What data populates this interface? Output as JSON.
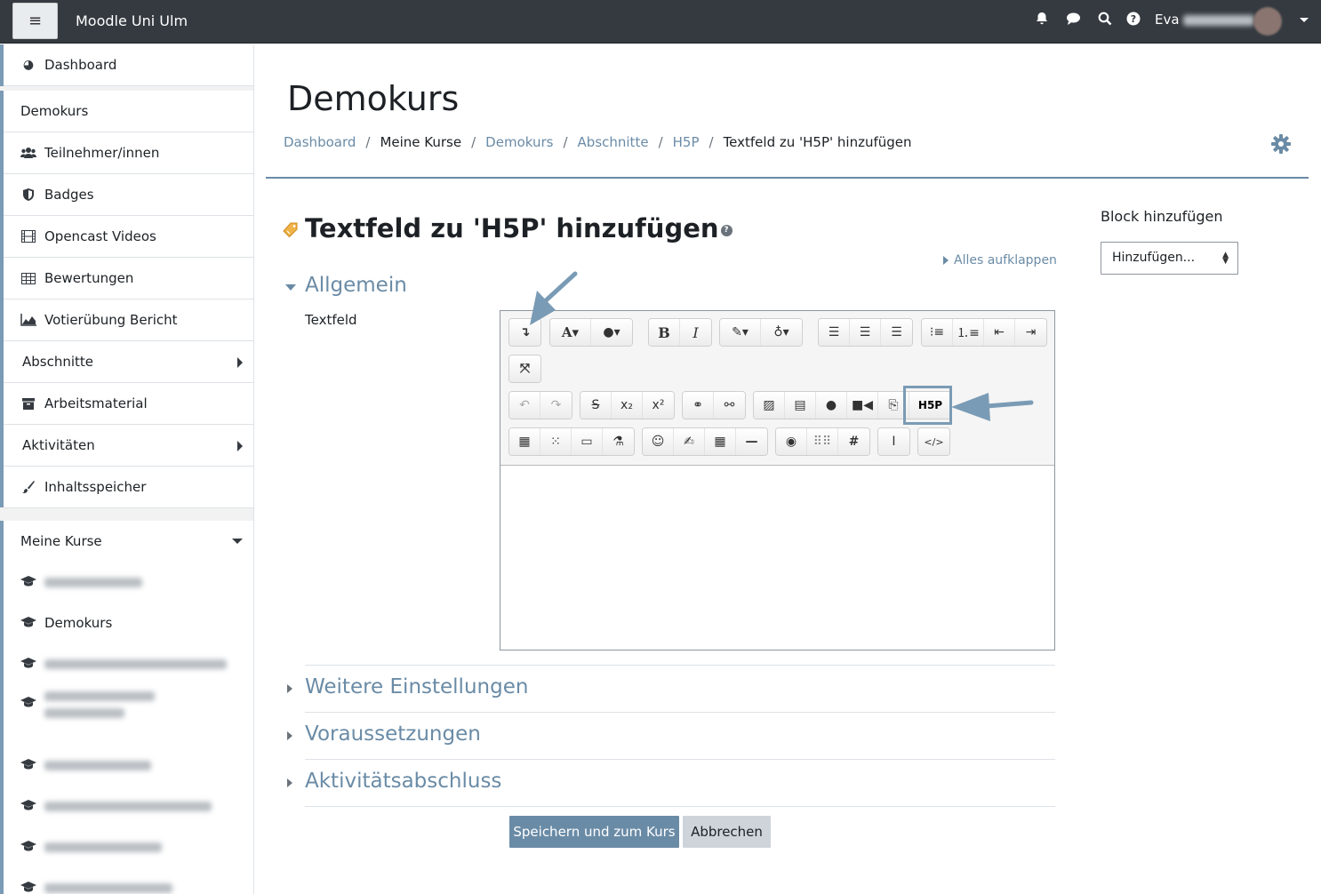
{
  "navbar": {
    "menu_icon": "hamburger-icon",
    "site_name": "Moodle Uni Ulm",
    "user_name": "Eva",
    "icons": [
      "bell-icon",
      "chat-icon",
      "search-icon",
      "help-icon"
    ]
  },
  "drawer": {
    "group1": [
      {
        "label": "Dashboard",
        "icon": "dashboard-icon"
      }
    ],
    "group2": [
      {
        "label": "Demokurs",
        "icon": ""
      },
      {
        "label": "Teilnehmer/innen",
        "icon": "users-icon"
      },
      {
        "label": "Badges",
        "icon": "shield-icon"
      },
      {
        "label": "Opencast Videos",
        "icon": "film-icon"
      },
      {
        "label": "Bewertungen",
        "icon": "table-icon"
      },
      {
        "label": "Votierübung Bericht",
        "icon": "chart-icon"
      },
      {
        "label": "Abschnitte",
        "icon": ""
      },
      {
        "label": "Arbeitsmaterial",
        "icon": "archive-icon"
      },
      {
        "label": "Aktivitäten",
        "icon": ""
      },
      {
        "label": "Inhaltsspeicher",
        "icon": "brush-icon"
      }
    ],
    "my_courses": {
      "label": "Meine Kurse",
      "courses": [
        "",
        "Demokurs",
        "",
        "",
        "",
        "",
        "",
        ""
      ]
    }
  },
  "main": {
    "page_title": "Demokurs",
    "breadcrumb": [
      {
        "label": "Dashboard",
        "link": true
      },
      {
        "label": "Meine Kurse",
        "link": false
      },
      {
        "label": "Demokurs",
        "link": true
      },
      {
        "label": "Abschnitte",
        "link": true
      },
      {
        "label": "H5P",
        "link": true
      },
      {
        "label": "Textfeld zu 'H5P' hinzufügen",
        "link": false
      }
    ],
    "form_title": "Textfeld zu 'H5P' hinzufügen",
    "expand_all": "Alles aufklappen",
    "sections": {
      "general": "Allgemein",
      "more": "Weitere Einstellungen",
      "restrictions": "Voraussetzungen",
      "completion": "Aktivitätsabschluss"
    },
    "field_label": "Textfeld",
    "editor_value": "",
    "buttons": {
      "save": "Speichern und zum Kurs",
      "cancel": "Abbrechen"
    }
  },
  "toolbar": {
    "rows": [
      [
        [
          "collapse-icon"
        ],
        [
          "font-style-icon",
          "font-color-icon"
        ],
        [
          "bold-icon",
          "italic-icon"
        ],
        [
          "highlight-icon",
          "accessibility-checker-icon"
        ],
        [
          "align-left-icon",
          "align-center-icon",
          "align-right-icon"
        ],
        [
          "unordered-list-icon",
          "ordered-list-icon",
          "outdent-icon",
          "indent-icon"
        ]
      ],
      [
        [
          "fullscreen-icon"
        ]
      ],
      [
        [
          "undo-icon",
          "redo-icon"
        ],
        [
          "strikethrough-icon",
          "subscript-icon",
          "superscript-icon"
        ],
        [
          "link-icon",
          "unlink-icon"
        ],
        [
          "image-icon",
          "media-icon",
          "record-audio-icon",
          "record-video-icon",
          "manage-files-icon",
          "h5p-icon"
        ]
      ],
      [
        [
          "calculator-icon",
          "keypad-icon",
          "screen-icon",
          "chemistry-icon"
        ],
        [
          "emoji-icon",
          "edit-icon",
          "table-icon",
          "horizontal-rule-icon"
        ],
        [
          "accessibility-icon",
          "braille-icon",
          "hash-icon"
        ],
        [
          "cursor-icon"
        ],
        [
          "html-icon"
        ]
      ]
    ],
    "labels": {
      "bold": "B",
      "italic": "I",
      "subscript": "x₂",
      "superscript": "x²",
      "h5p": "H5P",
      "html": "</>"
    }
  },
  "block": {
    "title": "Block hinzufügen",
    "select_value": "Hinzufügen..."
  }
}
